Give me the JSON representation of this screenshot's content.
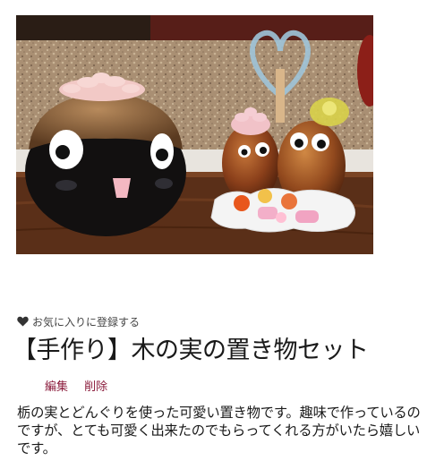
{
  "item": {
    "image_alt": "栃の実とどんぐりの置き物",
    "favorite_label": "お気に入りに登録する",
    "title": "【手作り】木の実の置き物セット",
    "edit_label": "編集",
    "delete_label": "削除",
    "description": "栃の実とどんぐりを使った可愛い置き物です。趣味で作っているのですが、とても可愛く出来たのでもらってくれる方がいたら嬉しいです。"
  },
  "colors": {
    "action_link": "#8b1c3c",
    "text": "#1a1a1a",
    "heart": "#333333"
  },
  "icons": {
    "favorite": "heart-icon"
  }
}
